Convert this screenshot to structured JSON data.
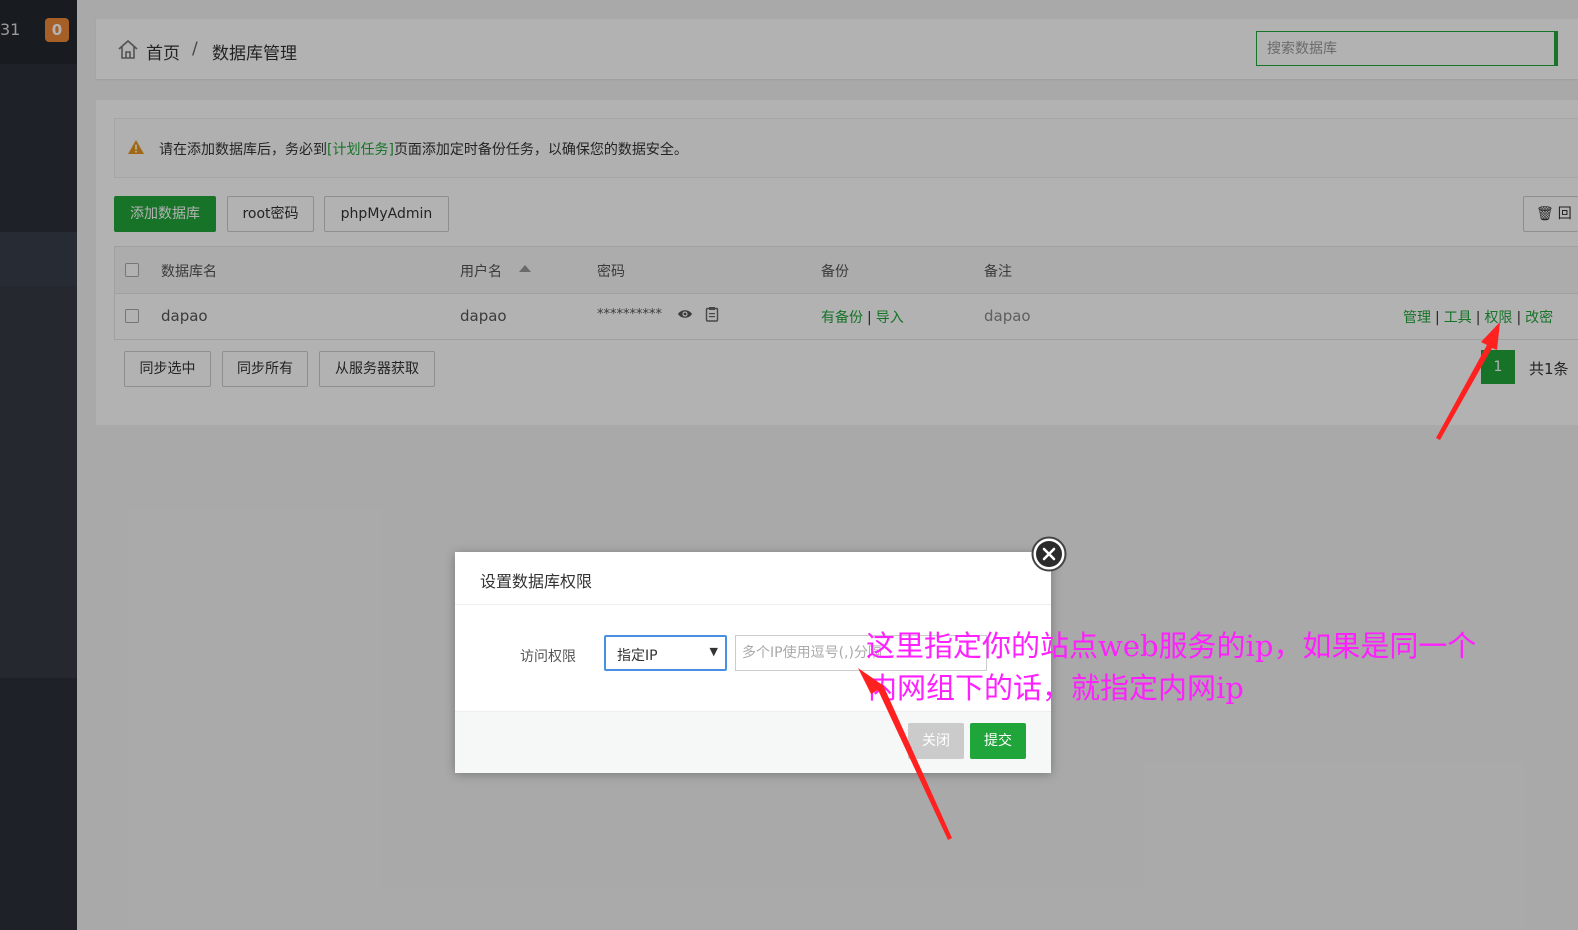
{
  "sidebar": {
    "server_num": "31",
    "badge_count": "0"
  },
  "breadcrumb": {
    "home": "首页",
    "separator": "/",
    "current": "数据库管理"
  },
  "search": {
    "placeholder": "搜索数据库"
  },
  "alert": {
    "text_before": "请在添加数据库后，务必到",
    "link": "[计划任务]",
    "text_after": "页面添加定时备份任务，以确保您的数据安全。"
  },
  "toolbar": {
    "add_db": "添加数据库",
    "root_pwd": "root密码",
    "phpmyadmin": "phpMyAdmin",
    "recycle": "回"
  },
  "table": {
    "headers": [
      "数据库名",
      "用户名",
      "密码",
      "备份",
      "备注"
    ],
    "rows": [
      {
        "db_name": "dapao",
        "username": "dapao",
        "password": "**********",
        "backup_has": "有备份",
        "backup_import": "导入",
        "note": "dapao",
        "actions": [
          "管理",
          "工具",
          "权限",
          "改密"
        ]
      }
    ]
  },
  "bottom_buttons": {
    "sync_selected": "同步选中",
    "sync_all": "同步所有",
    "fetch_server": "从服务器获取"
  },
  "pager": {
    "current": "1",
    "total": "共1条"
  },
  "dialog": {
    "title": "设置数据库权限",
    "label": "访问权限",
    "select_value": "指定IP",
    "input_placeholder": "多个IP使用逗号(,)分隔",
    "close": "关闭",
    "submit": "提交"
  },
  "annotation": {
    "line1": "这里指定你的站点web服务的ip，如果是同一个",
    "line2": "内网组下的话，就指定内网ip",
    "color": "#ff1fff"
  },
  "colors": {
    "accent": "#20a53a",
    "badge": "#f0893a"
  },
  "icons": [
    "home-icon",
    "warning-icon",
    "eye-icon",
    "copy-icon",
    "trash-icon",
    "close-icon",
    "chevron-down-icon"
  ]
}
